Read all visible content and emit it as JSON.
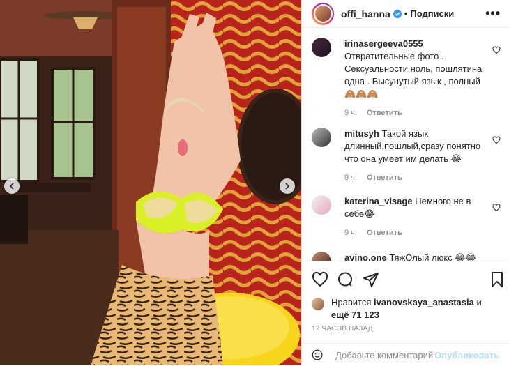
{
  "post": {
    "username": "offi_hanna",
    "follow_label": "Подписки",
    "more_label": "•••",
    "dot": "•"
  },
  "comments": [
    {
      "username": "irinasergeeva0555",
      "text": "Отвратительные фото . Сексуальности ноль, пошлятина одна . Высунутый язык , полный 🙈🙈🙈",
      "time": "9 ч.",
      "reply_label": "Ответить"
    },
    {
      "username": "mitusyh",
      "text": "Такой язык длинный,пошлый,сразу понятно что она умеет им делать 😂",
      "time": "9 ч.",
      "reply_label": "Ответить"
    },
    {
      "username": "katerina_visage",
      "text": "Немного не в себе😂",
      "time": "9 ч.",
      "reply_label": "Ответить"
    },
    {
      "username": "avino.one",
      "text": "ТяжОлый люкс 😂😂"
    }
  ],
  "likes": {
    "prefix": "Нравится",
    "user": "ivanovskaya_anastasia",
    "and": "и",
    "more": "ещё 71 123"
  },
  "time_ago": "12 ЧАСОВ НАЗАД",
  "add_comment": {
    "placeholder": "Добавьте комментарий...",
    "publish_label": "Опубликовать"
  },
  "colors": {
    "accent": "#0095f6",
    "publish_disabled": "#b2dffc",
    "muted": "#8e8e8e",
    "wall_red": "#b8241c",
    "wall_gold": "#e0a23a",
    "bra_neon": "#d9f026",
    "chair_yellow": "#f7d51d"
  }
}
